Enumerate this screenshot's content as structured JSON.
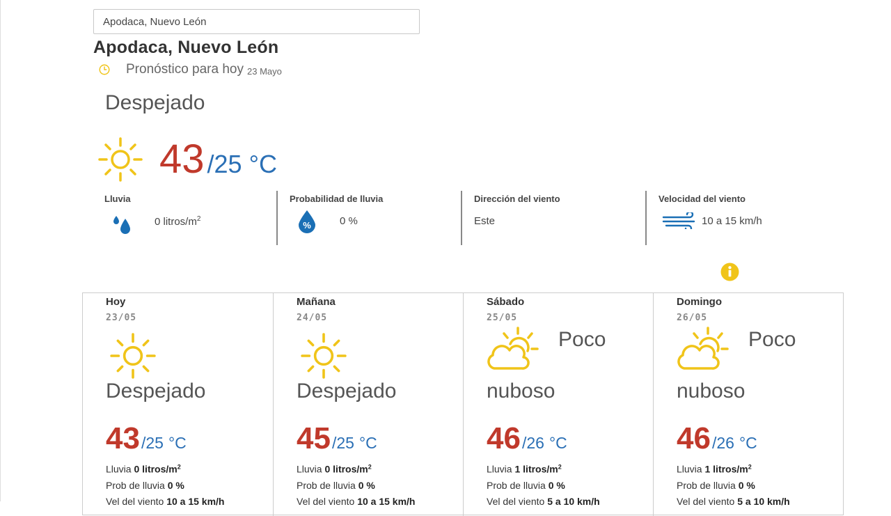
{
  "search": {
    "value": "Apodaca, Nuevo León"
  },
  "city_title": "Apodaca, Nuevo León",
  "today": {
    "forecast_label": "Pronóstico para hoy",
    "date": "23 Mayo",
    "condition": "Despejado",
    "temp_max": "43",
    "temp_min": "/25",
    "unit": "°C",
    "stats": {
      "rain_label": "Lluvia",
      "rain_value": "0 litros/m",
      "rain_sup": "2",
      "prob_label": "Probabilidad de lluvia",
      "prob_value": "0 %",
      "wind_dir_label": "Dirección del viento",
      "wind_dir_value": "Este",
      "wind_speed_label": "Velocidad del viento",
      "wind_speed_value": "10 a 15 km/h"
    }
  },
  "cards": [
    {
      "day": "Hoy",
      "date": "23/05",
      "icon": "sun-icon",
      "condition": "Despejado",
      "max": "43",
      "min": "/25",
      "unit": "°C",
      "rain_label": "Lluvia",
      "rain": "0 litros/m",
      "rain_sup": "2",
      "prob_label": "Prob de lluvia",
      "prob": "0 %",
      "wind_label": "Vel del viento",
      "wind": "10 a 15 km/h"
    },
    {
      "day": "Mañana",
      "date": "24/05",
      "icon": "sun-icon",
      "condition": "Despejado",
      "max": "45",
      "min": "/25",
      "unit": "°C",
      "rain_label": "Lluvia",
      "rain": "0 litros/m",
      "rain_sup": "2",
      "prob_label": "Prob de lluvia",
      "prob": "0 %",
      "wind_label": "Vel del viento",
      "wind": "10 a 15 km/h"
    },
    {
      "day": "Sábado",
      "date": "25/05",
      "icon": "partly-cloudy-icon",
      "condition_side": "Poco",
      "condition": "nuboso",
      "max": "46",
      "min": "/26",
      "unit": "°C",
      "rain_label": "Lluvia",
      "rain": "1 litros/m",
      "rain_sup": "2",
      "prob_label": "Prob de lluvia",
      "prob": "0 %",
      "wind_label": "Vel del viento",
      "wind": "5 a 10 km/h"
    },
    {
      "day": "Domingo",
      "date": "26/05",
      "icon": "partly-cloudy-icon",
      "condition_side": "Poco",
      "condition": "nuboso",
      "max": "46",
      "min": "/26",
      "unit": "°C",
      "rain_label": "Lluvia",
      "rain": "1 litros/m",
      "rain_sup": "2",
      "prob_label": "Prob de lluvia",
      "prob": "0 %",
      "wind_label": "Vel del viento",
      "wind": "5 a 10 km/h"
    }
  ],
  "colors": {
    "sun": "#f0c419",
    "temp_max": "#c0392b",
    "temp_min": "#2a6fb5",
    "drop": "#1a6fb5",
    "info": "#f0c419"
  }
}
